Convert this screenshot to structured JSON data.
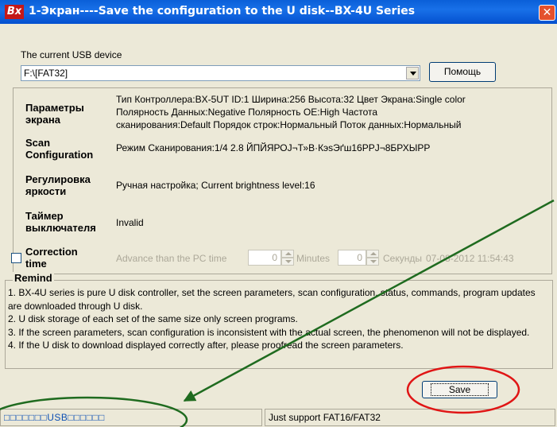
{
  "window": {
    "icon_text": "Bx",
    "title": "1-Экран----Save the configuration to the U disk--BX-4U Series",
    "close_glyph": "✕"
  },
  "usb": {
    "label": "The current USB device",
    "value": "F:\\[FAT32]",
    "help_button": "Помощь"
  },
  "params": {
    "screen_label": "Параметры экрана",
    "screen_line1": "Тип Контроллера:BX-5UT  ID:1  Ширина:256  Высота:32  Цвет Экрана:Single color",
    "screen_line2": "Полярность Данных:Negative  Полярность OE:High  Частота",
    "screen_line3": "сканирования:Default  Порядок строк:Нормальный  Поток данных:Нормальный",
    "scan_label": "Scan Configuration",
    "scan_value": "Режим Сканирования:1/4   2.8  ЙПЙЯРОЈ¬Т»В·КэѕЭґш16РРЈ¬8БРХЫРР",
    "brightness_label": "Регулировка яркости",
    "brightness_value": "Ручная настройка;  Current brightness level:16",
    "timer_label": "Таймер выключателя",
    "timer_value": "Invalid"
  },
  "correction": {
    "label": "Correction time",
    "advance_text": "Advance than the PC time",
    "minutes_value": "0",
    "minutes_label": "Minutes",
    "seconds_value": "0",
    "seconds_label": "Секунды",
    "datetime": "07-08-2012 11:54:43"
  },
  "remind": {
    "title": "Remind",
    "line1": "  1.  BX-4U series is pure U disk controller, set the screen parameters, scan configuration, status, commands, program updates are downloaded through U disk.",
    "line2": "  2.  U disk storage of each set of the same size only screen programs.",
    "line3": "  3.  If the screen parameters, scan configuration is inconsistent with the actual screen, the phenomenon will not be displayed.",
    "line4": "  4.  If the U disk to download displayed correctly after, please proofread the screen parameters."
  },
  "actions": {
    "save": "Save"
  },
  "status": {
    "left": "□□□□□□□USB□□□□□□",
    "right": "Just support FAT16/FAT32"
  },
  "colors": {
    "titlebar": "#0a5fd8",
    "arrow": "#1f6b1f",
    "red_highlight": "#e01515",
    "green_highlight": "#1f6b1f"
  }
}
